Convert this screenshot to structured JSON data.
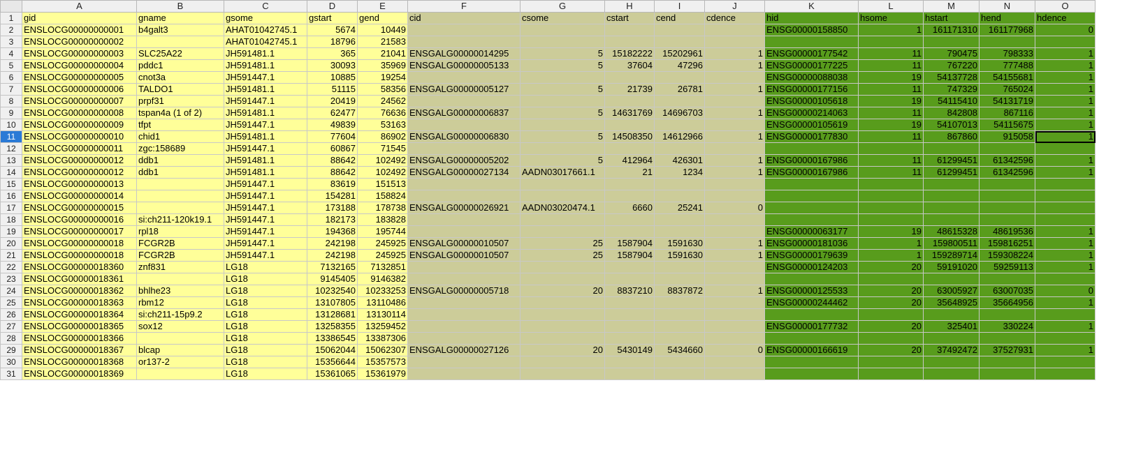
{
  "columns": [
    "A",
    "B",
    "C",
    "D",
    "E",
    "F",
    "G",
    "H",
    "I",
    "J",
    "K",
    "L",
    "M",
    "N",
    "O"
  ],
  "header_row": [
    "gid",
    "gname",
    "gsome",
    "gstart",
    "gend",
    "cid",
    "csome",
    "cstart",
    "cend",
    "cdence",
    "hid",
    "hsome",
    "hstart",
    "hend",
    "hdence"
  ],
  "rows": [
    [
      "ENSLOCG00000000001",
      "b4galt3",
      "AHAT01042745.1",
      "5674",
      "10449",
      "",
      "",
      "",
      "",
      "",
      "ENSG00000158850",
      "1",
      "161171310",
      "161177968",
      "0"
    ],
    [
      "ENSLOCG00000000002",
      "",
      "AHAT01042745.1",
      "18796",
      "21583",
      "",
      "",
      "",
      "",
      "",
      "",
      "",
      "",
      "",
      ""
    ],
    [
      "ENSLOCG00000000003",
      "SLC25A22",
      "JH591481.1",
      "365",
      "21041",
      "ENSGALG00000014295",
      "5",
      "15182222",
      "15202961",
      "1",
      "ENSG00000177542",
      "11",
      "790475",
      "798333",
      "1"
    ],
    [
      "ENSLOCG00000000004",
      "pddc1",
      "JH591481.1",
      "30093",
      "35969",
      "ENSGALG00000005133",
      "5",
      "37604",
      "47296",
      "1",
      "ENSG00000177225",
      "11",
      "767220",
      "777488",
      "1"
    ],
    [
      "ENSLOCG00000000005",
      "cnot3a",
      "JH591447.1",
      "10885",
      "19254",
      "",
      "",
      "",
      "",
      "",
      "ENSG00000088038",
      "19",
      "54137728",
      "54155681",
      "1"
    ],
    [
      "ENSLOCG00000000006",
      "TALDO1",
      "JH591481.1",
      "51115",
      "58356",
      "ENSGALG00000005127",
      "5",
      "21739",
      "26781",
      "1",
      "ENSG00000177156",
      "11",
      "747329",
      "765024",
      "1"
    ],
    [
      "ENSLOCG00000000007",
      "prpf31",
      "JH591447.1",
      "20419",
      "24562",
      "",
      "",
      "",
      "",
      "",
      "ENSG00000105618",
      "19",
      "54115410",
      "54131719",
      "1"
    ],
    [
      "ENSLOCG00000000008",
      "tspan4a (1 of 2)",
      "JH591481.1",
      "62477",
      "76636",
      "ENSGALG00000006837",
      "5",
      "14631769",
      "14696703",
      "1",
      "ENSG00000214063",
      "11",
      "842808",
      "867116",
      "1"
    ],
    [
      "ENSLOCG00000000009",
      "tfpt",
      "JH591447.1",
      "49839",
      "53163",
      "",
      "",
      "",
      "",
      "",
      "ENSG00000105619",
      "19",
      "54107013",
      "54115675",
      "1"
    ],
    [
      "ENSLOCG00000000010",
      "chid1",
      "JH591481.1",
      "77604",
      "86902",
      "ENSGALG00000006830",
      "5",
      "14508350",
      "14612966",
      "1",
      "ENSG00000177830",
      "11",
      "867860",
      "915058",
      "1"
    ],
    [
      "ENSLOCG00000000011",
      "zgc:158689",
      "JH591447.1",
      "60867",
      "71545",
      "",
      "",
      "",
      "",
      "",
      "",
      "",
      "",
      "",
      ""
    ],
    [
      "ENSLOCG00000000012",
      "ddb1",
      "JH591481.1",
      "88642",
      "102492",
      "ENSGALG00000005202",
      "5",
      "412964",
      "426301",
      "1",
      "ENSG00000167986",
      "11",
      "61299451",
      "61342596",
      "1"
    ],
    [
      "ENSLOCG00000000012",
      "ddb1",
      "JH591481.1",
      "88642",
      "102492",
      "ENSGALG00000027134",
      "AADN03017661.1",
      "21",
      "1234",
      "1",
      "ENSG00000167986",
      "11",
      "61299451",
      "61342596",
      "1"
    ],
    [
      "ENSLOCG00000000013",
      "",
      "JH591447.1",
      "83619",
      "151513",
      "",
      "",
      "",
      "",
      "",
      "",
      "",
      "",
      "",
      ""
    ],
    [
      "ENSLOCG00000000014",
      "",
      "JH591447.1",
      "154281",
      "158824",
      "",
      "",
      "",
      "",
      "",
      "",
      "",
      "",
      "",
      ""
    ],
    [
      "ENSLOCG00000000015",
      "",
      "JH591447.1",
      "173188",
      "178738",
      "ENSGALG00000026921",
      "AADN03020474.1",
      "6660",
      "25241",
      "0",
      "",
      "",
      "",
      "",
      ""
    ],
    [
      "ENSLOCG00000000016",
      "si:ch211-120k19.1",
      "JH591447.1",
      "182173",
      "183828",
      "",
      "",
      "",
      "",
      "",
      "",
      "",
      "",
      "",
      ""
    ],
    [
      "ENSLOCG00000000017",
      "rpl18",
      "JH591447.1",
      "194368",
      "195744",
      "",
      "",
      "",
      "",
      "",
      "ENSG00000063177",
      "19",
      "48615328",
      "48619536",
      "1"
    ],
    [
      "ENSLOCG00000000018",
      "FCGR2B",
      "JH591447.1",
      "242198",
      "245925",
      "ENSGALG00000010507",
      "25",
      "1587904",
      "1591630",
      "1",
      "ENSG00000181036",
      "1",
      "159800511",
      "159816251",
      "1"
    ],
    [
      "ENSLOCG00000000018",
      "FCGR2B",
      "JH591447.1",
      "242198",
      "245925",
      "ENSGALG00000010507",
      "25",
      "1587904",
      "1591630",
      "1",
      "ENSG00000179639",
      "1",
      "159289714",
      "159308224",
      "1"
    ],
    [
      "ENSLOCG00000018360",
      "znf831",
      "LG18",
      "7132165",
      "7132851",
      "",
      "",
      "",
      "",
      "",
      "ENSG00000124203",
      "20",
      "59191020",
      "59259113",
      "1"
    ],
    [
      "ENSLOCG00000018361",
      "",
      "LG18",
      "9145405",
      "9146382",
      "",
      "",
      "",
      "",
      "",
      "",
      "",
      "",
      "",
      ""
    ],
    [
      "ENSLOCG00000018362",
      "bhlhe23",
      "LG18",
      "10232540",
      "10233253",
      "ENSGALG00000005718",
      "20",
      "8837210",
      "8837872",
      "1",
      "ENSG00000125533",
      "20",
      "63005927",
      "63007035",
      "0"
    ],
    [
      "ENSLOCG00000018363",
      "rbm12",
      "LG18",
      "13107805",
      "13110486",
      "",
      "",
      "",
      "",
      "",
      "ENSG00000244462",
      "20",
      "35648925",
      "35664956",
      "1"
    ],
    [
      "ENSLOCG00000018364",
      "si:ch211-15p9.2",
      "LG18",
      "13128681",
      "13130114",
      "",
      "",
      "",
      "",
      "",
      "",
      "",
      "",
      "",
      ""
    ],
    [
      "ENSLOCG00000018365",
      "sox12",
      "LG18",
      "13258355",
      "13259452",
      "",
      "",
      "",
      "",
      "",
      "ENSG00000177732",
      "20",
      "325401",
      "330224",
      "1"
    ],
    [
      "ENSLOCG00000018366",
      "",
      "LG18",
      "13386545",
      "13387306",
      "",
      "",
      "",
      "",
      "",
      "",
      "",
      "",
      "",
      ""
    ],
    [
      "ENSLOCG00000018367",
      "blcap",
      "LG18",
      "15062044",
      "15062307",
      "ENSGALG00000027126",
      "20",
      "5430149",
      "5434660",
      "0",
      "ENSG00000166619",
      "20",
      "37492472",
      "37527931",
      "1"
    ],
    [
      "ENSLOCG00000018368",
      "or137-2",
      "LG18",
      "15356644",
      "15357573",
      "",
      "",
      "",
      "",
      "",
      "",
      "",
      "",
      "",
      ""
    ],
    [
      "ENSLOCG00000018369",
      "",
      "LG18",
      "15361065",
      "15361979",
      "",
      "",
      "",
      "",
      "",
      "",
      "",
      "",
      "",
      ""
    ]
  ],
  "colors": {
    "yellow": "#ffff99",
    "tan": "#cccc99",
    "green": "#589c1c",
    "selected_row_header": "#2a7ad6"
  }
}
